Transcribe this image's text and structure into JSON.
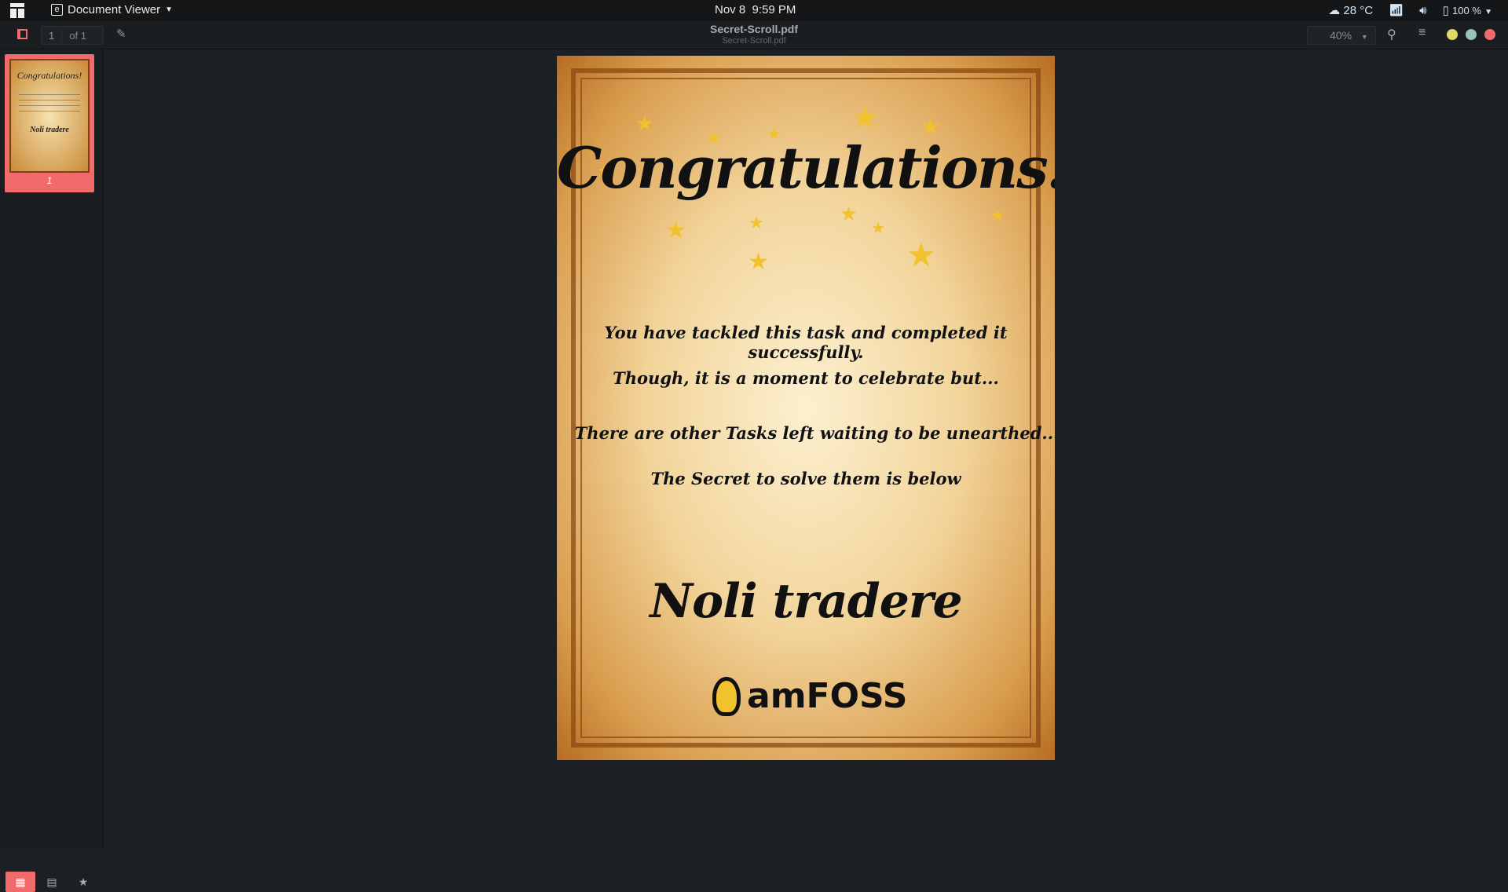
{
  "topbar": {
    "app_name": "Document Viewer",
    "clock": "Nov 8  9:59 PM",
    "weather": "28 °C",
    "battery": "100 %"
  },
  "toolbar": {
    "page_current": "1",
    "page_total": "of 1",
    "title": "Secret-Scroll.pdf",
    "subtitle": "Secret-Scroll.pdf",
    "zoom": "40%"
  },
  "sidebar": {
    "thumb_page": "1",
    "thumb_title": "Congratulations!",
    "thumb_motto": "Noli tradere"
  },
  "document": {
    "heading": "Congratulations!",
    "lines": [
      "You have tackled this task and completed it successfully.",
      "Though, it is a moment to celebrate but...",
      "There are other Tasks left waiting to be unearthed...",
      "The Secret to solve them is below"
    ],
    "motto": "Noli tradere",
    "logo_text": "amFOSS"
  },
  "colors": {
    "accent": "#f26b6b",
    "window_min": "#e2d86a",
    "window_max": "#95c4b8",
    "window_close": "#f26b6b"
  }
}
